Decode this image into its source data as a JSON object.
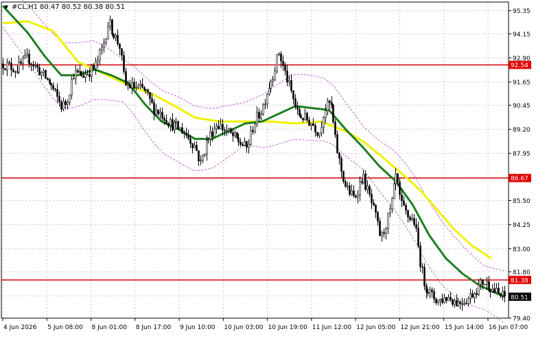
{
  "header": {
    "symbol": "#CL,H1",
    "ohlc": "80.47 80.52 80.38 80.51",
    "menu_glyph": "▼"
  },
  "colors": {
    "background": "#ffffff",
    "grid": "#c8c8c8",
    "candle": "#000000",
    "ma_fast": "#1e7d1e",
    "ma_slow": "#f0f000",
    "bands": "#b040c8",
    "level_line": "#d80000",
    "level_tag": "#e00000",
    "current_tag": "#000000",
    "axis_text": "#000000"
  },
  "chart_data": {
    "type": "candlestick",
    "title": "#CL,H1",
    "ohlc_label": "80.47 80.52 80.38 80.51",
    "ylim": [
      79.4,
      95.8
    ],
    "y_ticks": [
      "95.35",
      "94.15",
      "92.90",
      "91.65",
      "90.45",
      "89.20",
      "87.95",
      "86.70",
      "85.50",
      "84.25",
      "83.00",
      "81.80",
      "80.55",
      "79.40"
    ],
    "x_ticks": [
      "4 Jun 2026",
      "5 Jun 08:00",
      "8 Jun 01:00",
      "8 Jun 17:00",
      "9 Jun 10:00",
      "10 Jun 03:00",
      "10 Jun 19:00",
      "11 Jun 12:00",
      "12 Jun 05:00",
      "12 Jun 21:00",
      "15 Jun 14:00",
      "16 Jun 07:00"
    ],
    "levels": [
      {
        "label": "92.54",
        "value": 92.54
      },
      {
        "label": "86.67",
        "value": 86.67
      },
      {
        "label": "81.38",
        "value": 81.38
      }
    ],
    "current_price": {
      "label": "80.51",
      "value": 80.51
    },
    "close_path": [
      [
        0,
        92.6
      ],
      [
        8,
        92.3
      ],
      [
        15,
        92.9
      ],
      [
        22,
        92.2
      ],
      [
        28,
        91.6
      ],
      [
        35,
        90.4
      ],
      [
        38,
        90.6
      ],
      [
        42,
        92.1
      ],
      [
        48,
        92.0
      ],
      [
        55,
        92.4
      ],
      [
        60,
        93.6
      ],
      [
        63,
        94.8
      ],
      [
        66,
        94.2
      ],
      [
        70,
        93.5
      ],
      [
        73,
        91.5
      ],
      [
        78,
        91.4
      ],
      [
        85,
        91.2
      ],
      [
        90,
        90.3
      ],
      [
        95,
        90.0
      ],
      [
        100,
        89.5
      ],
      [
        108,
        89.1
      ],
      [
        115,
        88.3
      ],
      [
        118,
        87.4
      ],
      [
        122,
        88.6
      ],
      [
        128,
        89.5
      ],
      [
        135,
        89.0
      ],
      [
        142,
        88.5
      ],
      [
        146,
        88.2
      ],
      [
        150,
        89.5
      ],
      [
        155,
        90.3
      ],
      [
        158,
        91.2
      ],
      [
        162,
        92.2
      ],
      [
        165,
        93.2
      ],
      [
        168,
        92.3
      ],
      [
        172,
        91.2
      ],
      [
        176,
        90.0
      ],
      [
        180,
        89.8
      ],
      [
        185,
        89.5
      ],
      [
        189,
        89.0
      ],
      [
        192,
        90.2
      ],
      [
        196,
        90.6
      ],
      [
        199,
        88.5
      ],
      [
        202,
        87.2
      ],
      [
        205,
        86.2
      ],
      [
        210,
        85.6
      ],
      [
        215,
        86.8
      ],
      [
        220,
        85.5
      ],
      [
        223,
        84.6
      ],
      [
        226,
        83.5
      ],
      [
        229,
        84.3
      ],
      [
        232,
        85.1
      ],
      [
        235,
        86.8
      ],
      [
        238,
        85.3
      ],
      [
        242,
        84.7
      ],
      [
        246,
        84.4
      ],
      [
        250,
        82.0
      ],
      [
        252,
        81.2
      ],
      [
        256,
        80.6
      ],
      [
        260,
        80.3
      ],
      [
        266,
        80.5
      ],
      [
        272,
        80.2
      ],
      [
        278,
        80.4
      ],
      [
        283,
        80.9
      ],
      [
        287,
        81.3
      ],
      [
        291,
        81.1
      ],
      [
        294,
        80.8
      ],
      [
        297,
        80.6
      ],
      [
        300,
        80.5
      ]
    ],
    "ma_fast": [
      [
        0,
        95.6
      ],
      [
        15,
        94.2
      ],
      [
        25,
        93.0
      ],
      [
        35,
        92.0
      ],
      [
        45,
        92.0
      ],
      [
        55,
        92.3
      ],
      [
        65,
        92.0
      ],
      [
        75,
        91.6
      ],
      [
        85,
        90.5
      ],
      [
        95,
        89.6
      ],
      [
        105,
        89.2
      ],
      [
        115,
        88.7
      ],
      [
        125,
        88.7
      ],
      [
        135,
        89.1
      ],
      [
        145,
        89.5
      ],
      [
        155,
        89.6
      ],
      [
        165,
        90.0
      ],
      [
        175,
        90.4
      ],
      [
        185,
        90.3
      ],
      [
        195,
        90.2
      ],
      [
        205,
        89.2
      ],
      [
        215,
        88.3
      ],
      [
        225,
        87.3
      ],
      [
        235,
        86.5
      ],
      [
        245,
        85.3
      ],
      [
        255,
        83.7
      ],
      [
        265,
        82.5
      ],
      [
        275,
        81.7
      ],
      [
        285,
        81.1
      ],
      [
        300,
        80.5
      ]
    ],
    "ma_slow": [
      [
        0,
        94.7
      ],
      [
        15,
        94.8
      ],
      [
        30,
        94.3
      ],
      [
        45,
        92.7
      ],
      [
        60,
        92.1
      ],
      [
        75,
        91.5
      ],
      [
        90,
        91.0
      ],
      [
        105,
        90.3
      ],
      [
        115,
        89.8
      ],
      [
        130,
        89.6
      ],
      [
        145,
        89.6
      ],
      [
        160,
        89.6
      ],
      [
        175,
        89.5
      ],
      [
        190,
        89.6
      ],
      [
        205,
        89.1
      ],
      [
        215,
        88.6
      ],
      [
        225,
        87.9
      ],
      [
        240,
        86.8
      ],
      [
        250,
        86.0
      ],
      [
        260,
        85.0
      ],
      [
        270,
        84.0
      ],
      [
        280,
        83.2
      ],
      [
        292,
        82.5
      ]
    ]
  }
}
